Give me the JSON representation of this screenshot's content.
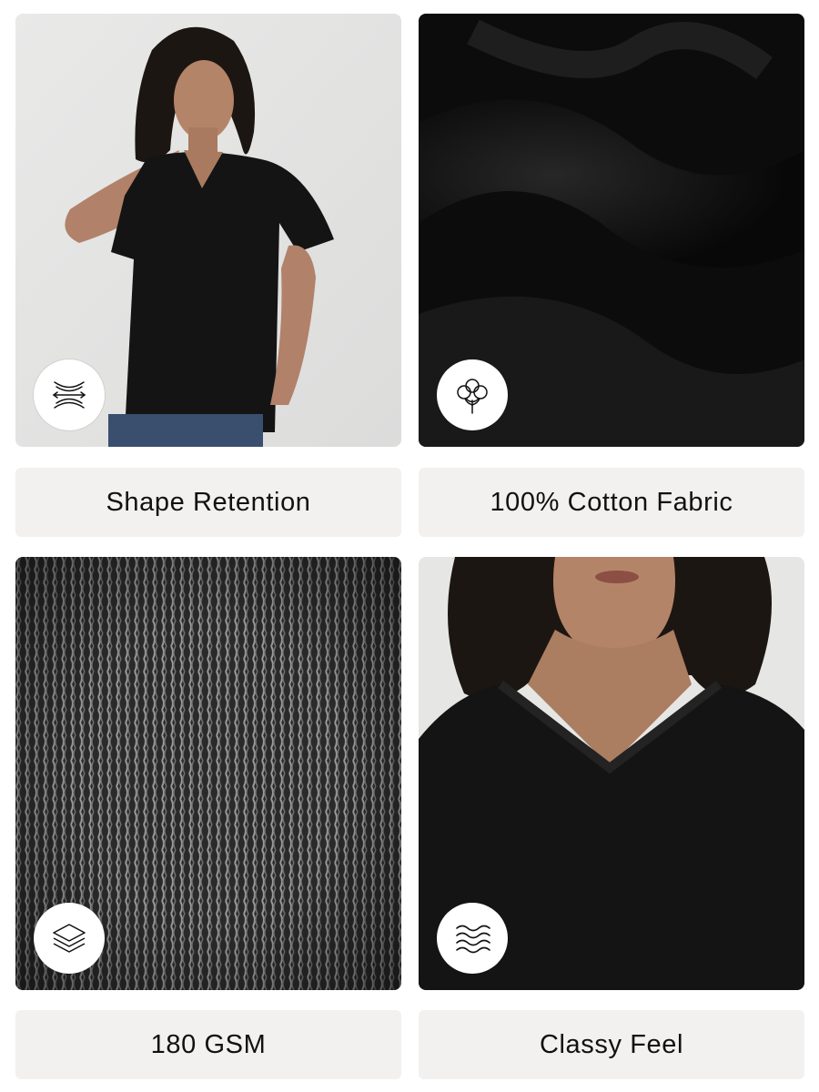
{
  "features": [
    {
      "label": "Shape Retention",
      "icon": "stretch-icon",
      "image": "model-black-vneck-tshirt-photo"
    },
    {
      "label": "100% Cotton Fabric",
      "icon": "cotton-flower-icon",
      "image": "black-fabric-closeup-photo"
    },
    {
      "label": "180 GSM",
      "icon": "layers-icon",
      "image": "knit-texture-closeup-photo"
    },
    {
      "label": "Classy Feel",
      "icon": "waves-icon",
      "image": "vneck-neckline-closeup-photo"
    }
  ],
  "colors": {
    "label_background": "#f2f1f0",
    "label_text": "#111111",
    "badge_background": "#ffffff",
    "garment": "#141414"
  }
}
